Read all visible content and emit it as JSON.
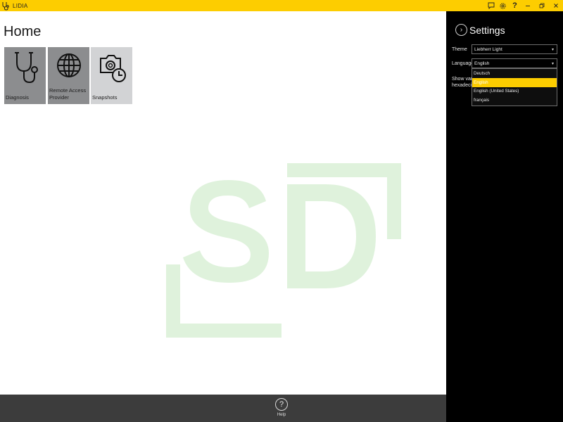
{
  "window": {
    "title": "LIDIA"
  },
  "titlebar": {
    "tools": [
      "chat-icon",
      "gear-icon",
      "help-icon"
    ],
    "controls": [
      "minimize-icon",
      "restore-icon",
      "close-icon"
    ]
  },
  "home": {
    "title": "Home",
    "tiles": [
      {
        "label": "Diagnosis",
        "icon": "stethoscope-icon"
      },
      {
        "label_line1": "Remote Access",
        "label_line2": "Provider",
        "icon": "globe-icon"
      },
      {
        "label": "Snapshots",
        "icon": "camera-clock-icon"
      }
    ]
  },
  "bottom": {
    "help_label": "Help",
    "help_glyph": "?"
  },
  "settings": {
    "title": "Settings",
    "theme_label": "Theme",
    "theme_value": "Liebherr Light",
    "language_label": "Language",
    "language_value": "English",
    "show_label_line1": "Show vari",
    "show_label_line2": "hexadecim",
    "language_options": [
      "Deutsch",
      "English",
      "English (United States)",
      "français"
    ],
    "language_selected_index": 1
  },
  "colors": {
    "accent": "#fdcd00",
    "tile_dark": "#8c8d8f",
    "tile_light": "#d2d3d5",
    "panel": "#000000",
    "bottombar": "#3c3c3c"
  }
}
